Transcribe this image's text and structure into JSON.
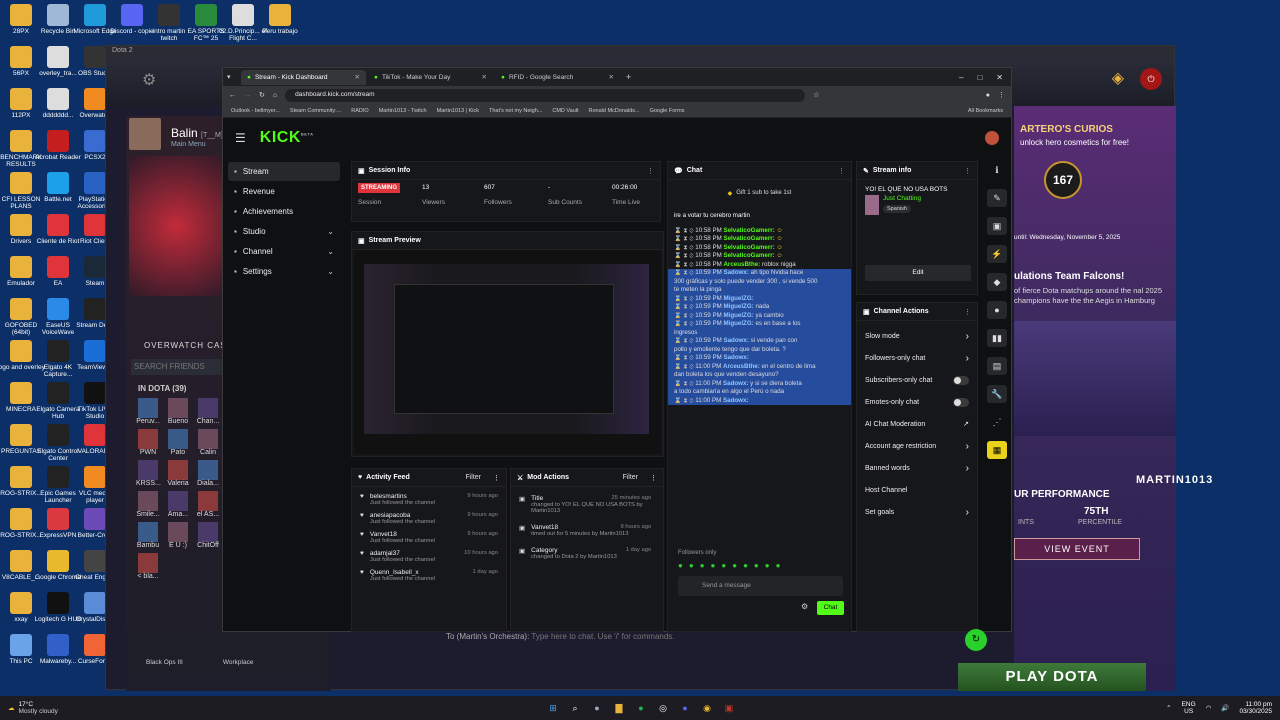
{
  "desktop": {
    "icons": [
      {
        "label": "28PX",
        "c": "#e9b23a"
      },
      {
        "label": "Recycle Bin",
        "c": "#9fb8d6"
      },
      {
        "label": "Microsoft Edge",
        "c": "#1f9bd9"
      },
      {
        "label": "Discord - copie",
        "c": "#5865f2"
      },
      {
        "label": "intro martin twitch",
        "c": "#333"
      },
      {
        "label": "EA SPORTS FC™ 25",
        "c": "#2a8a3c"
      },
      {
        "label": "02.D.Princip... of Flight C...",
        "c": "#ddd"
      },
      {
        "label": "Peru trabajo",
        "c": "#e9b23a"
      },
      {
        "label": "56PX",
        "c": "#e9b23a"
      },
      {
        "label": "overley_tra...",
        "c": "#ddd"
      },
      {
        "label": "OBS Studio",
        "c": "#333"
      },
      {
        "label": "112PX",
        "c": "#e9b23a"
      },
      {
        "label": "ddddddd...",
        "c": "#ddd"
      },
      {
        "label": "Overwatch",
        "c": "#f18a21"
      },
      {
        "label": "BENCHMARK RESULTS",
        "c": "#e9b23a"
      },
      {
        "label": "Acrobat Reader",
        "c": "#c41e1e"
      },
      {
        "label": "PCSX2",
        "c": "#3a6bd1"
      },
      {
        "label": "CFI LESSON PLANS",
        "c": "#e9b23a"
      },
      {
        "label": "Battle.net",
        "c": "#1ca0e8"
      },
      {
        "label": "PlayStation Accessories",
        "c": "#2a62c4"
      },
      {
        "label": "Drivers",
        "c": "#e9b23a"
      },
      {
        "label": "Cliente de Riot",
        "c": "#e0343b"
      },
      {
        "label": "Riot Client",
        "c": "#e0343b"
      },
      {
        "label": "Emulador",
        "c": "#e9b23a"
      },
      {
        "label": "EA",
        "c": "#e0343b"
      },
      {
        "label": "Steam",
        "c": "#1b2838"
      },
      {
        "label": "GOFOBED (64bit)",
        "c": "#e9b23a"
      },
      {
        "label": "EaseUS VoiceWave",
        "c": "#2a8ae8"
      },
      {
        "label": "Stream Deck",
        "c": "#222"
      },
      {
        "label": "logo and overley",
        "c": "#e9b23a"
      },
      {
        "label": "Elgato 4K Capture...",
        "c": "#222"
      },
      {
        "label": "TeamViewer",
        "c": "#1a6fd6"
      },
      {
        "label": "MINECRA",
        "c": "#e9b23a"
      },
      {
        "label": "Elgato Camera Hub",
        "c": "#222"
      },
      {
        "label": "TikTok LIVE Studio",
        "c": "#111"
      },
      {
        "label": "PREGUNTAS",
        "c": "#e9b23a"
      },
      {
        "label": "Elgato Control Center",
        "c": "#222"
      },
      {
        "label": "VALORANT",
        "c": "#e0343b"
      },
      {
        "label": "ROG-STRIX...",
        "c": "#e9b23a"
      },
      {
        "label": "Epic Games Launcher",
        "c": "#222"
      },
      {
        "label": "VLC media player",
        "c": "#f18a21"
      },
      {
        "label": "ROG-STRIX...",
        "c": "#e9b23a"
      },
      {
        "label": "ExpressVPN",
        "c": "#da3940"
      },
      {
        "label": "Better-Crew",
        "c": "#6c4ab8"
      },
      {
        "label": "V8CABLE_...",
        "c": "#e9b23a"
      },
      {
        "label": "Google Chrome",
        "c": "#e8b92d"
      },
      {
        "label": "Cheat Engine",
        "c": "#444"
      },
      {
        "label": "xxay",
        "c": "#e9b23a"
      },
      {
        "label": "Logitech G HUB",
        "c": "#111"
      },
      {
        "label": "CrystalDisk...",
        "c": "#5a8bd6"
      },
      {
        "label": "This PC",
        "c": "#6aa3e8"
      },
      {
        "label": "Malwareby...",
        "c": "#3060c8"
      },
      {
        "label": "CurseForge",
        "c": "#f16436"
      }
    ]
  },
  "dota": {
    "window_title": "Dota 2",
    "profile_name": "Balin",
    "profile_tag": "[T__M]",
    "profile_sub": "Main Menu",
    "case_label": "OVERWATCH CASE",
    "search_friends": "SEARCH FRIENDS",
    "in_dota": "IN DOTA (39)",
    "friends": [
      "Peruv...",
      "Bueno",
      "Chan...",
      "PWN",
      "Pato",
      "Calin",
      "KRSS...",
      "Valeria",
      "Diala...",
      "Smile...",
      "Ama...",
      "el AS...",
      "Bambu",
      "E U :)",
      "ChitOff",
      "< bla..."
    ],
    "chat_placeholder": "Type here to chat. Use '/' for commands.",
    "chat_to": "To (Martin's Orchestra):",
    "curios_title": "ARTERO'S CURIOS",
    "curios_sub": "unlock hero cosmetics for free!",
    "curios_level": "167",
    "curios_date": "until: Wednesday, November 5, 2025",
    "falcons_title": "ulations Team Falcons!",
    "falcons_text": "of fierce Dota matchups around the nal 2025 champions have the the Aegis in Hamburg",
    "perf_label": "UR PERFORMANCE",
    "perf_percentile": "75TH",
    "perf_percentile_lab": "PERCENTILE",
    "perf_points_lab": "INTS",
    "view_event": "VIEW EVENT",
    "play_dota": "PLAY DOTA",
    "watermark": "MARTIN1013",
    "taskbar_names": [
      "Black Ops III",
      "Workplace"
    ]
  },
  "browser": {
    "tabs": [
      {
        "label": "Stream - Kick Dashboard",
        "active": true
      },
      {
        "label": "TikTok - Make Your Day",
        "active": false
      },
      {
        "label": "RFID - Google Search",
        "active": false
      }
    ],
    "url": "dashboard.kick.com/stream",
    "bookmarks": [
      "Outlook - bellmyer...",
      "Steam Community:...",
      "RADIO",
      "Martin1013 - Twitch",
      "Martin1013 | Kick",
      "That's not my Neigh...",
      "CMD Vault",
      "Ronald McDonalds...",
      "Google Forms"
    ],
    "all_bookmarks": "All Bookmarks"
  },
  "kick": {
    "logo": "KICK",
    "beta": "BETA",
    "nav": [
      {
        "label": "Stream",
        "active": true,
        "chev": false
      },
      {
        "label": "Revenue",
        "chev": false
      },
      {
        "label": "Achievements",
        "chev": false
      },
      {
        "label": "Studio",
        "chev": true
      },
      {
        "label": "Channel",
        "chev": true
      },
      {
        "label": "Settings",
        "chev": true
      }
    ],
    "session": {
      "title": "Session Info",
      "status": "STREAMING",
      "status_lab": "Session",
      "viewers": "13",
      "viewers_lab": "Viewers",
      "followers": "607",
      "followers_lab": "Followers",
      "subs": "-",
      "subs_lab": "Sub Counts",
      "time": "00:26:00",
      "time_lab": "Time Live"
    },
    "preview_title": "Stream Preview",
    "chat": {
      "title": "Chat",
      "gift": "Gift 1 sub to take 1st",
      "vote": "ire a votar tu cerebro martin",
      "lines": [
        {
          "time": "10:58 PM",
          "user": "SelvaticoGamerr:",
          "text": "",
          "sel": false
        },
        {
          "time": "10:58 PM",
          "user": "SelvaticoGamerr:",
          "text": "",
          "sel": false
        },
        {
          "time": "10:58 PM",
          "user": "SelvaticoGamerr:",
          "text": "",
          "sel": false
        },
        {
          "time": "10:58 PM",
          "user": "SelvaticoGamerr:",
          "text": "",
          "sel": false
        },
        {
          "time": "10:58 PM",
          "user": "ArceusBthe:",
          "text": "roblox nigga",
          "sel": false
        },
        {
          "time": "10:59 PM",
          "user": "Sadowx:",
          "text": "ah tipo Nvidia hace",
          "sel": true
        },
        {
          "time": "",
          "user": "",
          "text": "300 gráficas y solo puede vender 300 , si vende 500",
          "sel": true
        },
        {
          "time": "",
          "user": "",
          "text": "te meten la pinga",
          "sel": true
        },
        {
          "time": "10:59 PM",
          "user": "MiguelZG:",
          "text": "",
          "sel": true
        },
        {
          "time": "10:59 PM",
          "user": "MiguelZG:",
          "text": "nada",
          "sel": true
        },
        {
          "time": "10:59 PM",
          "user": "MiguelZG:",
          "text": "ya cambio",
          "sel": true
        },
        {
          "time": "10:59 PM",
          "user": "MiguelZG:",
          "text": "es en base a los",
          "sel": true
        },
        {
          "time": "",
          "user": "",
          "text": "ingresos",
          "sel": true
        },
        {
          "time": "10:59 PM",
          "user": "Sadowx:",
          "text": "si vende pan con",
          "sel": true
        },
        {
          "time": "",
          "user": "",
          "text": "pollo y emoliente tengo que dar boleta. ?",
          "sel": true
        },
        {
          "time": "10:59 PM",
          "user": "Sadowx:",
          "text": "",
          "sel": true
        },
        {
          "time": "11:00 PM",
          "user": "ArceusBthe:",
          "text": "en el centro de lima",
          "sel": true
        },
        {
          "time": "",
          "user": "",
          "text": "dan boleta los que venden desayuno?",
          "sel": true
        },
        {
          "time": "11:00 PM",
          "user": "Sadowx:",
          "text": "y si se diera boleta",
          "sel": true
        },
        {
          "time": "",
          "user": "",
          "text": "a todo cambiaría en algo el Perú o nada",
          "sel": true
        },
        {
          "time": "11:00 PM",
          "user": "Sadowx:",
          "text": "",
          "sel": true
        }
      ],
      "followers_only": "Followers only",
      "placeholder": "Send a message",
      "send": "Chat"
    },
    "stream_info": {
      "title": "Stream info",
      "stream_title": "YO! EL QUE NO USA BOTS",
      "category": "Just Chatting",
      "lang": "Spanish",
      "edit": "Edit"
    },
    "channel_actions": {
      "title": "Channel Actions",
      "items": [
        {
          "label": "Slow mode",
          "ctl": "chev"
        },
        {
          "label": "Followers-only chat",
          "ctl": "chev"
        },
        {
          "label": "Subscribers-only chat",
          "ctl": "toggle"
        },
        {
          "label": "Emotes-only chat",
          "ctl": "toggle"
        },
        {
          "label": "AI Chat Moderation",
          "ctl": "ext"
        },
        {
          "label": "Account age restriction",
          "ctl": "chev"
        },
        {
          "label": "Banned words",
          "ctl": "chev"
        },
        {
          "label": "Host Channel",
          "ctl": "none"
        },
        {
          "label": "Set goals",
          "ctl": "chev"
        }
      ]
    },
    "activity": {
      "title": "Activity Feed",
      "filter": "Filter",
      "items": [
        {
          "user": "belesmartins",
          "sub": "Just followed the channel",
          "time": "9 hours ago"
        },
        {
          "user": "anesiapacoba",
          "sub": "Just followed the channel",
          "time": "9 hours ago"
        },
        {
          "user": "Vanvet18",
          "sub": "Just followed the channel",
          "time": "9 hours ago"
        },
        {
          "user": "adamjal37",
          "sub": "Just followed the channel",
          "time": "10 hours ago"
        },
        {
          "user": "Quenn_Isabell_x",
          "sub": "Just followed the channel",
          "time": "1 day ago"
        }
      ]
    },
    "mod": {
      "title": "Mod Actions",
      "filter": "Filter",
      "items": [
        {
          "head": "Title",
          "time": "25 minutes ago",
          "text": "changed to YO! EL QUE NO USA BOTS by Martin1013"
        },
        {
          "head": "Vanvet18",
          "time": "9 hours ago",
          "text": "timed out for 5 minutes by Martin1013"
        },
        {
          "head": "Category",
          "time": "1 day ago",
          "text": "changed to Dota 2 by Martin1013"
        }
      ]
    }
  },
  "taskbar": {
    "temp": "17°C",
    "weather": "Mostly cloudy",
    "lang1": "ENG",
    "lang2": "US",
    "time": "11:00 pm",
    "date": "03/30/2025"
  }
}
